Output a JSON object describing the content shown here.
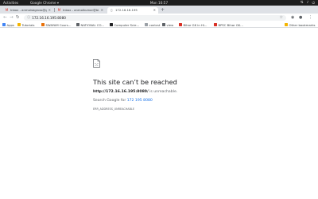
{
  "topbar": {
    "activities": "Activities",
    "app": "Google Chrome ▾",
    "clock": "Mon 16:57",
    "sys_icons": [
      "network-icon",
      "volume-icon",
      "power-icon"
    ]
  },
  "tabs": [
    {
      "title": "Inbox - anmolsbgross@g...",
      "active": false,
      "favicon": "gmail-icon"
    },
    {
      "title": "Inbox - anmolkumar@bi...",
      "active": false,
      "favicon": "gmail-icon"
    },
    {
      "title": "172.16.16.195",
      "active": true,
      "favicon": "document-icon"
    }
  ],
  "toolbar": {
    "url": "172.16.16.195:8080"
  },
  "bookmarks": {
    "items": [
      {
        "label": "Apps",
        "color": "#4285f4"
      },
      {
        "label": "Tutorials",
        "color": "#f4b400"
      },
      {
        "label": "SWAYAM Cours...",
        "color": "#e8710a"
      },
      {
        "label": "NATIONAL CO...",
        "color": "#5f6368"
      },
      {
        "label": "Computer Scie...",
        "color": "#202124"
      },
      {
        "label": "contcst",
        "color": "#9aa0a6"
      },
      {
        "label": "view",
        "color": "#5f6368"
      },
      {
        "label": "Bihar GK in Hi...",
        "color": "#d93025"
      },
      {
        "label": "BPSC Bihar GK...",
        "color": "#d93025"
      }
    ],
    "other": "Other bookmarks"
  },
  "error": {
    "title": "This site can’t be reached",
    "host": "http://172.16.16.195:8080/",
    "unreachable": " is unreachable.",
    "search_prefix": "Search Google for ",
    "search_link": "172 195 8080",
    "code": "ERR_ADDRESS_UNREACHABLE"
  }
}
